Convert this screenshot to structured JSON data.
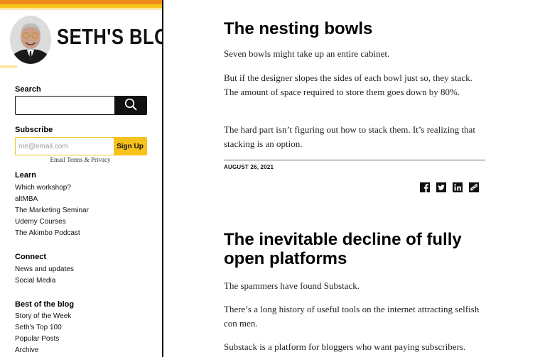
{
  "brand": {
    "title": "SETH'S BLOG"
  },
  "search": {
    "heading": "Search",
    "placeholder": ""
  },
  "subscribe": {
    "heading": "Subscribe",
    "placeholder": "me@email.com",
    "button": "Sign Up",
    "note": "Email Terms & Privacy"
  },
  "learn": {
    "heading": "Learn",
    "items": [
      "Which workshop?",
      "altMBA",
      "The Marketing Seminar",
      "Udemy Courses",
      "The Akimbo Podcast"
    ]
  },
  "connect": {
    "heading": "Connect",
    "items": [
      "News and updates",
      "Social Media"
    ]
  },
  "best": {
    "heading": "Best of the blog",
    "items": [
      "Story of the Week",
      "Seth's Top 100",
      "Popular Posts",
      "Archive"
    ]
  },
  "posts": [
    {
      "title": "The nesting bowls",
      "paragraphs": [
        "Seven bowls might take up an entire cabinet.",
        "But if the designer slopes the sides of each bowl just so, they stack. The amount of space required to store them goes down by 80%.",
        "The hard part isn’t figuring out how to stack them. It’s realizing that stacking is an option."
      ],
      "date": "AUGUST 26, 2021"
    },
    {
      "title": "The inevitable decline of fully open platforms",
      "paragraphs": [
        "The spammers have found Substack.",
        "There’s a long history of useful tools on the internet attracting selfish con men.",
        "Substack is a platform for bloggers who want paying subscribers."
      ]
    }
  ],
  "share_icons": [
    "facebook-icon",
    "twitter-icon",
    "linkedin-icon",
    "link-icon"
  ],
  "colors": {
    "orange": "#f08a1c",
    "yellow": "#f7c21b",
    "text": "#222222"
  }
}
